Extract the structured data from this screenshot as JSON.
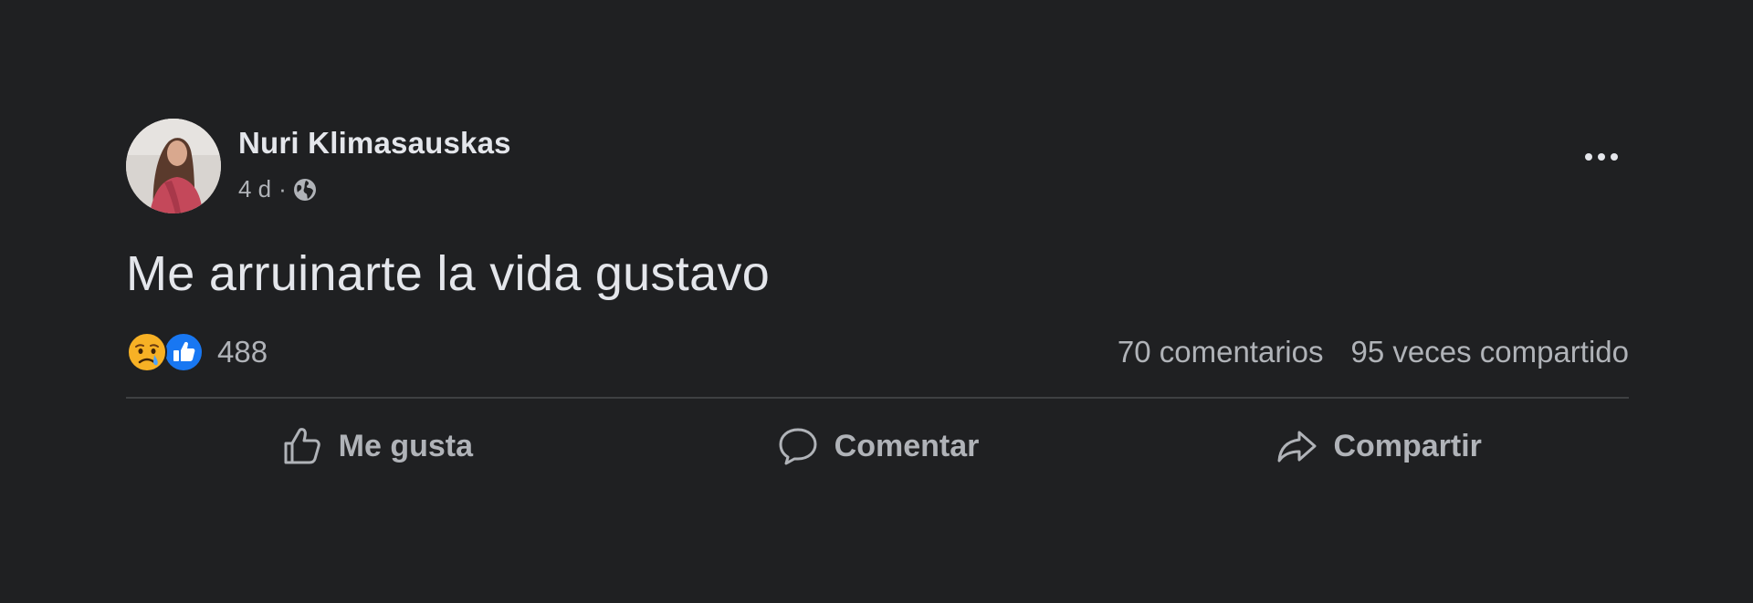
{
  "post": {
    "author": "Nuri Klimasauskas",
    "time": "4 d",
    "separator": "·",
    "privacy_icon": "globe-icon",
    "more_icon": "more-options-icon",
    "message": "Me arruinarte la vida gustavo",
    "reactions": {
      "icons": [
        "sad-reaction-icon",
        "like-reaction-icon"
      ],
      "count": "488"
    },
    "comments": "70 comentarios",
    "shares": "95 veces compartido"
  },
  "actions": {
    "like_label": "Me gusta",
    "comment_label": "Comentar",
    "share_label": "Compartir"
  },
  "colors": {
    "background": "#1f2022",
    "primary_text": "#e4e6eb",
    "secondary_text": "#b0b3b8",
    "divider": "#3e4042",
    "like_blue": "#1877f2",
    "sad_yellow": "#f7b125"
  }
}
